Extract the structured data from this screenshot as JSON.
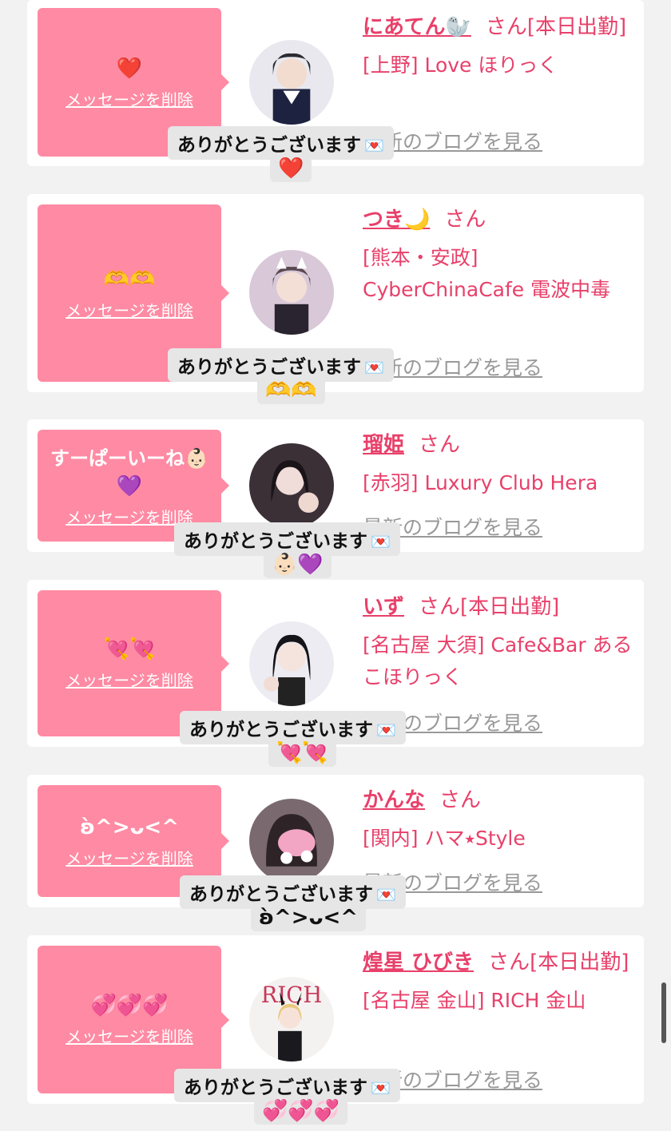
{
  "bubble_delete_label": "メッセージを削除",
  "blog_label": "最新のブログを見る",
  "san_label": "さん",
  "reply_label": "ありがとうございます",
  "reply_icon": "💌",
  "colors": {
    "bubble": "#ff8aa3",
    "accent": "#e8406a",
    "card": "#ffffff",
    "background": "#f2f2f2"
  },
  "entries": [
    {
      "message": "",
      "emoji": "❤️",
      "name": "にあてん🦭",
      "status": "[本日出勤]",
      "shop": "[上野] Love ほりっく",
      "reply_emoji": "❤️",
      "avatar_icon": "avatar-girl-1"
    },
    {
      "message": "",
      "emoji": "🫶🫶",
      "name": "つき🌙",
      "status": "",
      "shop": "[熊本・安政] CyberChinaCafe 電波中毒",
      "reply_emoji": "🫶🫶",
      "avatar_icon": "avatar-girl-2"
    },
    {
      "message": "すーぱーいーね👶🏻",
      "emoji": "💜",
      "name": "瑠姫",
      "status": "",
      "shop": "[赤羽] Luxury Club Hera",
      "reply_emoji": "👶🏻💜",
      "avatar_icon": "avatar-girl-3"
    },
    {
      "message": "",
      "emoji": "💘💘",
      "name": "いず",
      "status": "[本日出勤]",
      "shop": "[名古屋 大須] Cafe&Bar あるこほりっく",
      "reply_emoji": "💘💘",
      "avatar_icon": "avatar-girl-4"
    },
    {
      "message": "",
      "emoji": "ʚ̀^>ᴗ<^",
      "name": "かんな",
      "status": "",
      "shop": "[関内] ハマ⭑Style",
      "reply_emoji": "ʚ̀^>ᴗ<^",
      "avatar_icon": "avatar-girl-5"
    },
    {
      "message": "",
      "emoji": "💞💞💞",
      "name": "煌星 ひびき",
      "status": "[本日出勤]",
      "shop": "[名古屋 金山] RICH 金山",
      "reply_emoji": "💞💞💞",
      "avatar_icon": "avatar-girl-6"
    }
  ]
}
